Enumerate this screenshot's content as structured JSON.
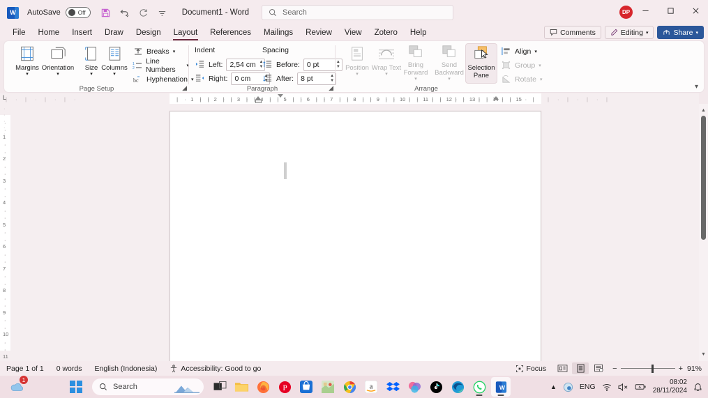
{
  "titlebar": {
    "app_icon": "word-logo-icon",
    "autosave_label": "AutoSave",
    "autosave_state": "Off",
    "document_title": "Document1  -  Word",
    "quick_access": [
      {
        "name": "save-icon",
        "label": "Save"
      },
      {
        "name": "undo-icon",
        "label": "Undo"
      },
      {
        "name": "redo-icon",
        "label": "Redo"
      },
      {
        "name": "customize-quick-access-icon",
        "label": "Customize Quick Access Toolbar"
      }
    ],
    "search_placeholder": "Search",
    "avatar_initials": "DP",
    "window_controls": [
      {
        "name": "minimize-button",
        "glyph": "─"
      },
      {
        "name": "maximize-button",
        "glyph": "❐"
      },
      {
        "name": "close-button",
        "glyph": "✕"
      }
    ]
  },
  "tabs": [
    {
      "label": "File",
      "active": false
    },
    {
      "label": "Home",
      "active": false
    },
    {
      "label": "Insert",
      "active": false
    },
    {
      "label": "Draw",
      "active": false
    },
    {
      "label": "Design",
      "active": false
    },
    {
      "label": "Layout",
      "active": true
    },
    {
      "label": "References",
      "active": false
    },
    {
      "label": "Mailings",
      "active": false
    },
    {
      "label": "Review",
      "active": false
    },
    {
      "label": "View",
      "active": false
    },
    {
      "label": "Zotero",
      "active": false
    },
    {
      "label": "Help",
      "active": false
    }
  ],
  "tab_right_buttons": {
    "comments": "Comments",
    "editing": "Editing",
    "share": "Share"
  },
  "ribbon": {
    "groups": [
      {
        "name": "Page Setup",
        "big_buttons": [
          {
            "label": "Margins",
            "icon": "margins-icon",
            "has_caret": true,
            "disabled": false
          },
          {
            "label": "Orientation",
            "icon": "orientation-icon",
            "has_caret": true,
            "disabled": false
          },
          {
            "label": "Size",
            "icon": "size-icon",
            "has_caret": true,
            "disabled": false
          },
          {
            "label": "Columns",
            "icon": "columns-icon",
            "has_caret": true,
            "disabled": false
          }
        ],
        "small_buttons": [
          {
            "label": "Breaks",
            "icon": "breaks-icon",
            "has_caret": true,
            "disabled": false
          },
          {
            "label": "Line Numbers",
            "icon": "line-numbers-icon",
            "has_caret": true,
            "disabled": false
          },
          {
            "label": "Hyphenation",
            "icon": "hyphenation-icon",
            "has_caret": true,
            "disabled": false
          }
        ]
      },
      {
        "name": "Paragraph",
        "headings": {
          "indent": "Indent",
          "spacing": "Spacing"
        },
        "fields": [
          {
            "label": "Left:",
            "value": "2,54 cm",
            "icon": "indent-left-icon"
          },
          {
            "label": "Right:",
            "value": "0 cm",
            "icon": "indent-right-icon"
          },
          {
            "label": "Before:",
            "value": "0 pt",
            "icon": "spacing-before-icon"
          },
          {
            "label": "After:",
            "value": "8 pt",
            "icon": "spacing-after-icon"
          }
        ]
      },
      {
        "name": "Arrange",
        "big_buttons": [
          {
            "label": "Position",
            "icon": "position-icon",
            "has_caret": true,
            "disabled": true
          },
          {
            "label": "Wrap Text",
            "icon": "wrap-text-icon",
            "has_caret": true,
            "disabled": true
          },
          {
            "label": "Bring Forward",
            "icon": "bring-forward-icon",
            "has_caret": true,
            "disabled": true
          },
          {
            "label": "Send Backward",
            "icon": "send-backward-icon",
            "has_caret": true,
            "disabled": true
          },
          {
            "label": "Selection Pane",
            "icon": "selection-pane-icon",
            "has_caret": false,
            "disabled": false,
            "hovered": true
          }
        ],
        "small_buttons": [
          {
            "label": "Align",
            "icon": "align-icon",
            "has_caret": true,
            "disabled": false
          },
          {
            "label": "Group",
            "icon": "group-icon",
            "has_caret": true,
            "disabled": true
          },
          {
            "label": "Rotate",
            "icon": "rotate-icon",
            "has_caret": true,
            "disabled": true
          }
        ]
      }
    ],
    "collapse_icon": "chevron-up-icon"
  },
  "ruler": {
    "horizontal_labels": [
      "1",
      "2",
      "3",
      "4",
      "5",
      "6",
      "7",
      "8",
      "9",
      "10",
      "11",
      "12",
      "13",
      "14",
      "15"
    ],
    "vertical_labels": [
      "1",
      "2",
      "3",
      "4",
      "5",
      "6",
      "7",
      "8",
      "9",
      "10",
      "11"
    ],
    "corner_marker": "L"
  },
  "document": {
    "caret": "text-cursor"
  },
  "statusbar": {
    "page": "Page 1 of 1",
    "words": "0 words",
    "language": "English (Indonesia)",
    "accessibility": "Accessibility: Good to go",
    "focus": "Focus",
    "views": [
      {
        "name": "read-mode-view-button",
        "active": false
      },
      {
        "name": "print-layout-view-button",
        "active": true
      },
      {
        "name": "web-layout-view-button",
        "active": false
      }
    ],
    "zoom_out": "−",
    "zoom_in": "+",
    "zoom_level": "91%"
  },
  "taskbar": {
    "onedrive_badge": "1",
    "search_placeholder": "Search",
    "apps": [
      {
        "name": "taskbar-start-button",
        "label": "Start"
      },
      {
        "name": "taskbar-search",
        "label": "Search"
      },
      {
        "name": "taskbar-task-view",
        "label": "Task View"
      },
      {
        "name": "taskbar-file-explorer",
        "label": "File Explorer"
      },
      {
        "name": "taskbar-firefox",
        "label": "Firefox"
      },
      {
        "name": "taskbar-pinterest",
        "label": "Pinterest"
      },
      {
        "name": "taskbar-microsoft-store",
        "label": "Microsoft Store"
      },
      {
        "name": "taskbar-maps",
        "label": "Maps"
      },
      {
        "name": "taskbar-chrome",
        "label": "Google Chrome"
      },
      {
        "name": "taskbar-amazon",
        "label": "Amazon"
      },
      {
        "name": "taskbar-dropbox",
        "label": "Dropbox"
      },
      {
        "name": "taskbar-copilot",
        "label": "Copilot"
      },
      {
        "name": "taskbar-tiktok",
        "label": "TikTok"
      },
      {
        "name": "taskbar-edge",
        "label": "Microsoft Edge"
      },
      {
        "name": "taskbar-whatsapp",
        "label": "WhatsApp"
      },
      {
        "name": "taskbar-word",
        "label": "Word"
      }
    ],
    "tray": {
      "language": "ENG",
      "time": "08:02",
      "date": "28/11/2024"
    }
  },
  "colors": {
    "window_bg": "#f5ebee",
    "taskbar_bg": "#f0dfe4",
    "ribbon_bg": "#fdfcfc",
    "accent_share": "#2b579a",
    "accent_tab_underline": "#6b2b3f",
    "avatar_red": "#d7262c",
    "page_white": "#ffffff"
  }
}
